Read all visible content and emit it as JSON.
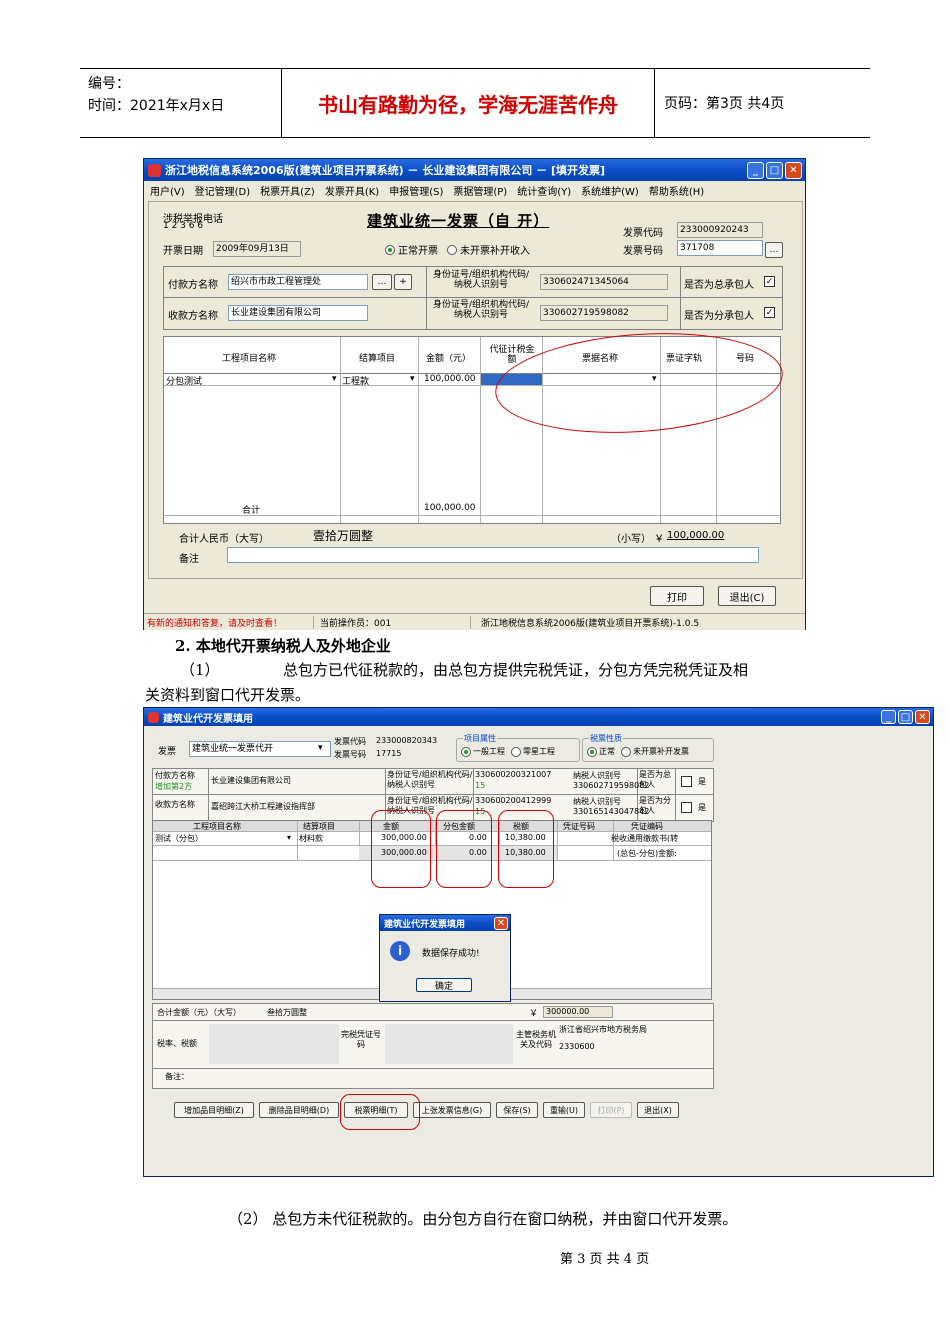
{
  "header": {
    "number_label": "编号：",
    "date_label": "时间：2021年x月x日",
    "motto": "书山有路勤为径，学海无涯苦作舟",
    "page_label": "页码：第3页  共4页"
  },
  "window1": {
    "title": "浙江地税信息系统2006版(建筑业项目开票系统)  －  长业建设集团有限公司  －  [填开发票]",
    "menu": [
      "用户(V)",
      "登记管理(D)",
      "税票开具(Z)",
      "发票开具(K)",
      "申报管理(S)",
      "票据管理(P)",
      "统计查询(Y)",
      "系统维护(W)",
      "帮助系统(H)"
    ],
    "hotline_label": "涉税举报电话",
    "hotline_number": "1 2 3 6 6",
    "invoice_title": "建筑业统一发票（自  开）",
    "invoice_code_label": "发票代码",
    "invoice_code": "233000920243",
    "invoice_number_label": "发票号码",
    "invoice_number": "371708",
    "issue_date_label": "开票日期",
    "issue_date": "2009年09月13日",
    "radio_normal": "正常开票",
    "radio_supplement": "未开票补开收入",
    "payer_label": "付款方名称",
    "payer_name": "绍兴市市政工程管理处",
    "id_label": "身份证号/组织机构代码/纳税人识别号",
    "payer_id": "330602471345064",
    "payer_general_q": "是否为总承包人",
    "payee_label": "收款方名称",
    "payee_name": "长业建设集团有限公司",
    "payee_id": "330602719598082",
    "payee_sub_q": "是否为分承包人",
    "columns": [
      "工程项目名称",
      "结算项目",
      "金额（元）",
      "代征计税金额",
      "票据名称",
      "票证字轨",
      "号码"
    ],
    "row1": [
      "分包测试",
      "工程款",
      "100,000.00"
    ],
    "subtotal_label": "合计",
    "subtotal_amount": "100,000.00",
    "total_rmb_label": "合计人民币（大写）",
    "total_rmb_words": "壹拾万圆整",
    "lower_label": "（小写）  ￥",
    "lower_amount": "100,000.00",
    "remark_label": "备注",
    "print_button": "打印",
    "exit_button": "退出(C)",
    "status_notice": "有新的通知和答复，请及时查看！",
    "status_operator": "当前操作员：001",
    "status_version": "浙江地税信息系统2006版(建筑业项目开票系统)-1.0.5"
  },
  "body_text": {
    "heading2": "2. 本地代开票纳税人及外地企业",
    "para1_num": "（1）",
    "para1_a": "总包方已代征税款的，由总包方提供完税凭证，分包方凭完税凭证及相",
    "para1_b": "关资料到窗口代开发票。",
    "para2": "（2）   总包方未代征税款的。由分包方自行在窗口纳税，并由窗口代开发票。",
    "footer": "第 3 页  共 4 页"
  },
  "window2": {
    "title": "建筑业代开发票填用",
    "invoice_label": "发票",
    "invoice_type": "建筑业统一发票代开",
    "invoice_code_label": "发票代码",
    "invoice_code": "233000820343",
    "invoice_number_label": "发票号码",
    "invoice_number": "17715",
    "project_attr_label": "项目属性",
    "project_general": "一般工程",
    "project_small": "零星工程",
    "ticket_nature_label": "税票性质",
    "ticket_normal": "正常",
    "ticket_supplement": "未开票补开发票",
    "payer_label": "付款方名称",
    "payer_extra": "增加第2方",
    "payer_name": "长业建设集团有限公司",
    "id_label": "身份证号/组织机构代码/纳税人识别号",
    "payer_id": "330600200321007",
    "payer_id2": "15",
    "taxpayer_label": "纳税人识别号",
    "payer_taxpayer": "330602719598082",
    "payer_general_q": "是否为总包人",
    "yes": "是",
    "payee_label": "收款方名称",
    "payee_name": "嘉绍跨江大桥工程建设指挥部",
    "payee_id": "330600200412999",
    "payee_id2": "15",
    "payee_taxpayer": "330165143047842",
    "payee_sub_q": "是否为分包人",
    "columns": [
      "工程项目名称",
      "结算项目",
      "金额",
      "分包金额",
      "税额",
      "凭证号码",
      "凭证编码"
    ],
    "row1": [
      "测试（分包）",
      "材料款",
      "300,000.00",
      "0.00",
      "10,380.00",
      "税收通用缴款书(转"
    ],
    "row2": [
      "300,000.00",
      "0.00",
      "10,380.00",
      "(总包-分包)金额:"
    ],
    "dialog_title": "建筑业代开发票填用",
    "dialog_message": "数据保存成功!",
    "dialog_ok": "确定",
    "total_label": "合计金额（元）（大写）",
    "total_words": "叁拾万圆整",
    "total_amount": "300000.00",
    "yen": "￥",
    "tax_rate_label": "税率、税额",
    "certificate_label": "完税凭证号码",
    "authority_label": "主管税务机关及代码",
    "authority_name": "浙江省绍兴市地方税务局",
    "authority_code": "2330600",
    "remark_label": "备注：",
    "buttons": [
      "增加品目明细(Z)",
      "删除品目明细(D)",
      "税票明细(T)",
      "上张发票信息(G)",
      "保存(S)",
      "重输(U)",
      "打印(P)",
      "退出(X)"
    ]
  }
}
